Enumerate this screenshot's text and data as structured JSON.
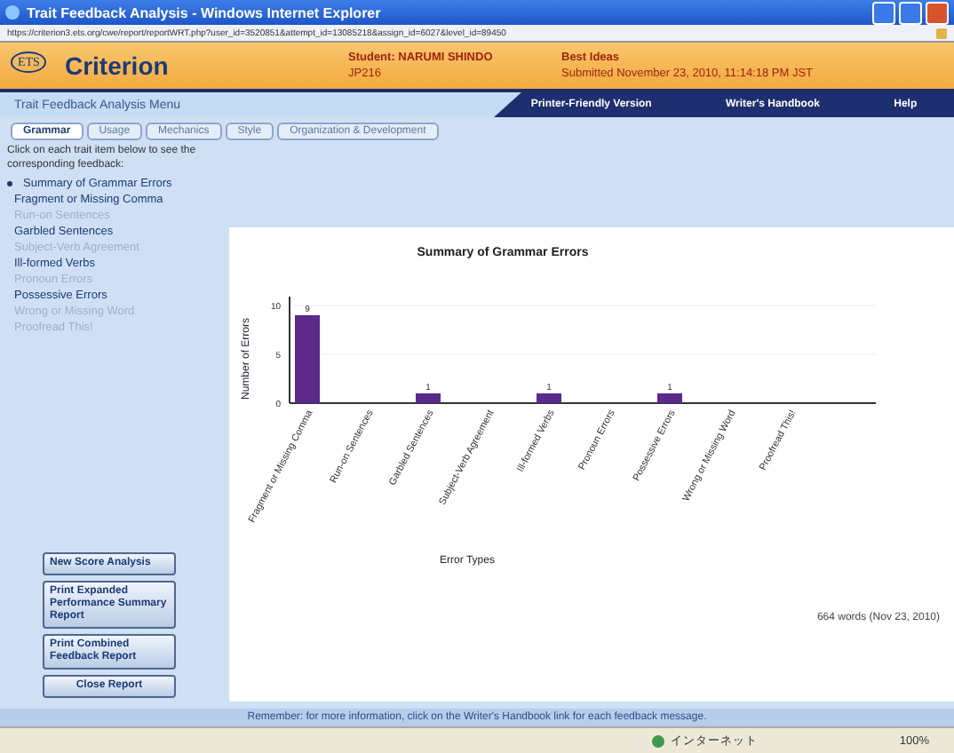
{
  "window": {
    "title": "Trait Feedback Analysis - Windows Internet Explorer"
  },
  "address_bar": {
    "url": "https://criterion3.ets.org/cwe/report/reportWRT.php?user_id=3520851&attempt_id=13085218&assign_id=6027&level_id=89450"
  },
  "header": {
    "logo_badge": "ETS",
    "logo_text": "Criterion",
    "student": "Student: NARUMI SHINDO",
    "class": "JP216",
    "essay_title": "Best Ideas",
    "submitted": "Submitted November 23, 2010, 11:14:18 PM JST"
  },
  "nav": {
    "title": "Trait Feedback Analysis Menu",
    "links": [
      "Printer-Friendly Version",
      "Writer's Handbook",
      "Help"
    ]
  },
  "tabs": [
    {
      "label": "Grammar",
      "selected": true
    },
    {
      "label": "Usage",
      "selected": false
    },
    {
      "label": "Mechanics",
      "selected": false
    },
    {
      "label": "Style",
      "selected": false
    },
    {
      "label": "Organization & Development",
      "selected": false
    }
  ],
  "sidebar": {
    "instructions": "Click on each trait item below to see the corresponding feedback:",
    "items": [
      {
        "label": "Summary of Grammar Errors",
        "current": true,
        "disabled": false
      },
      {
        "label": "Fragment or Missing Comma",
        "current": false,
        "disabled": false
      },
      {
        "label": "Run-on Sentences",
        "current": false,
        "disabled": true
      },
      {
        "label": "Garbled Sentences",
        "current": false,
        "disabled": false
      },
      {
        "label": "Subject-Verb Agreement",
        "current": false,
        "disabled": true
      },
      {
        "label": "Ill-formed Verbs",
        "current": false,
        "disabled": false
      },
      {
        "label": "Pronoun Errors",
        "current": false,
        "disabled": true
      },
      {
        "label": "Possessive Errors",
        "current": false,
        "disabled": false
      },
      {
        "label": "Wrong or Missing Word",
        "current": false,
        "disabled": true
      },
      {
        "label": "Proofread This!",
        "current": false,
        "disabled": true
      }
    ],
    "buttons": [
      "New Score Analysis",
      "Print Expanded Performance Summary Report",
      "Print Combined Feedback Report",
      "Close Report"
    ]
  },
  "chart": {
    "chart_data": {
      "type": "bar",
      "title": "Summary of Grammar Errors",
      "xlabel": "Error Types",
      "ylabel": "Number of Errors",
      "categories": [
        "Fragment or Missing Comma",
        "Run-on Sentences",
        "Garbled Sentences",
        "Subject-Verb Agreement",
        "Ill-formed Verbs",
        "Pronoun Errors",
        "Possessive Errors",
        "Wrong or Missing Word",
        "Proofread This!"
      ],
      "values": [
        9,
        0,
        1,
        0,
        1,
        0,
        1,
        0,
        0
      ],
      "ylim": [
        0,
        10
      ],
      "yticks": [
        0,
        5,
        10
      ],
      "value_labels": [
        "9",
        null,
        "1",
        null,
        "1",
        null,
        "1",
        null,
        null
      ]
    },
    "word_count": "664 words (Nov 23, 2010)"
  },
  "footer": {
    "message": "Remember: for more information, click on the Writer's Handbook link for each feedback message."
  },
  "status_bar": {
    "zone": "インターネット",
    "zoom": "100%"
  }
}
